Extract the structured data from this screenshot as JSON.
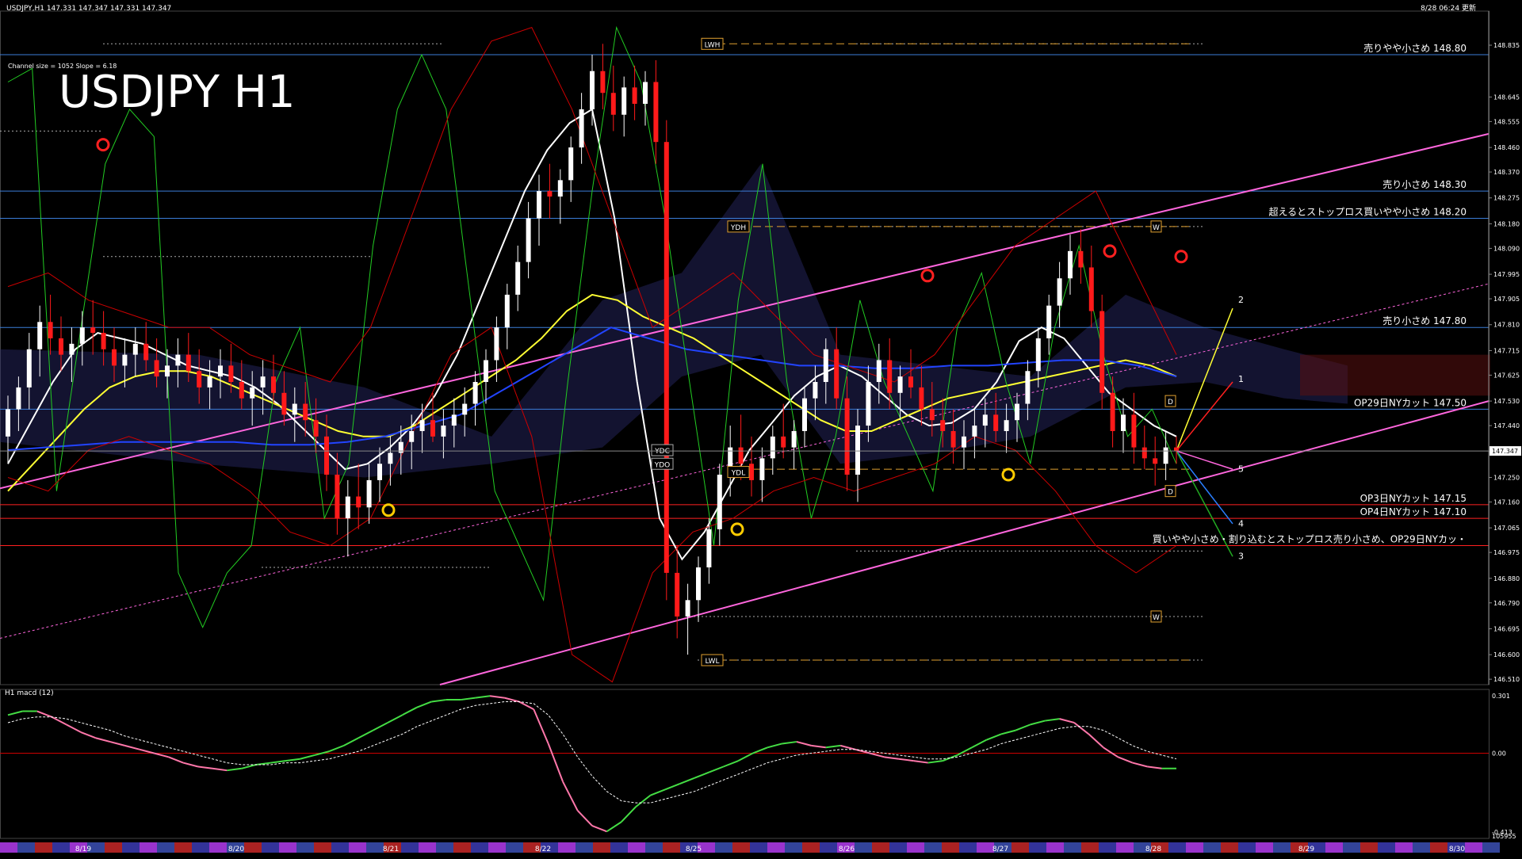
{
  "header": {
    "symbol_info": "USDJPY,H1  147.331 147.347 147.331 147.347",
    "channel_info": "Channel size = 1052 Slope = 6.18",
    "title": "USDJPY H1",
    "update_time": "8/28 06:24 更新"
  },
  "price_axis": {
    "ticks": [
      "148.835",
      "148.645",
      "148.555",
      "148.460",
      "148.370",
      "148.275",
      "148.180",
      "148.090",
      "147.995",
      "147.905",
      "147.810",
      "147.715",
      "147.625",
      "147.530",
      "147.440",
      "147.345",
      "147.250",
      "147.160",
      "147.065",
      "146.975",
      "146.880",
      "146.790",
      "146.695",
      "146.600",
      "146.510"
    ],
    "current_price": "147.347",
    "range": [
      146.49,
      148.96
    ]
  },
  "levels": [
    {
      "price": 148.8,
      "label": "売りやや小さめ 148.80",
      "color": "#3b7dd8"
    },
    {
      "price": 148.3,
      "label": "売り小さめ 148.30",
      "color": "#3b7dd8"
    },
    {
      "price": 148.2,
      "label": "超えるとストップロス買いやや小さめ 148.20",
      "color": "#3b7dd8"
    },
    {
      "price": 147.8,
      "label": "売り小さめ 147.80",
      "color": "#3b7dd8"
    },
    {
      "price": 147.5,
      "label": "OP29日NYカット 147.50",
      "color": "#3b7dd8"
    },
    {
      "price": 147.15,
      "label": "OP3日NYカット 147.15",
      "color": "#ff2020"
    },
    {
      "price": 147.1,
      "label": "OP4日NYカット 147.10",
      "color": "#ff2020"
    },
    {
      "price": 147.0,
      "label": "買いやや小さめ・割り込むとストップロス売り小さめ、OP29日NYカッ・",
      "color": "#ff2020"
    }
  ],
  "price_tags": [
    "LWH",
    "LWL",
    "YDH",
    "YDL",
    "YDC",
    "YDO",
    "W",
    "W",
    "D",
    "D"
  ],
  "wave_labels": [
    "1",
    "2",
    "3",
    "4",
    "5"
  ],
  "date_axis": [
    "8/19",
    "8/20",
    "8/21",
    "8/22",
    "8/25",
    "8/26",
    "8/27",
    "8/28",
    "8/29",
    "8/30"
  ],
  "macd": {
    "label": "H1 macd (12)",
    "ticks": [
      "0.301",
      "0.00",
      "-0.413",
      "105955"
    ],
    "range": [
      -0.413,
      0.301
    ]
  },
  "colors": {
    "background": "#000000",
    "up_candle": "#ffffff",
    "down_candle": "#ff1a1a",
    "channel": "#ff66dd",
    "ma_fast": "#ffffff",
    "ma_mid": "#ffff33",
    "ma_slow": "#2244ff",
    "oscillator": "#22cc22",
    "bollinger": "#cc0000",
    "level_blue": "#3b7dd8",
    "macd_up": "#44dd44",
    "macd_down": "#ff77aa",
    "signal": "#ffffff"
  },
  "chart_data": {
    "type": "candlestick",
    "title": "USDJPY H1",
    "x_categories": [
      "8/19",
      "8/20",
      "8/21",
      "8/22",
      "8/25",
      "8/26",
      "8/27",
      "8/28",
      "8/29",
      "8/30"
    ],
    "ylim": [
      146.49,
      148.96
    ],
    "ohlc": [
      [
        147.4,
        147.55,
        147.3,
        147.5
      ],
      [
        147.5,
        147.62,
        147.42,
        147.58
      ],
      [
        147.58,
        147.78,
        147.5,
        147.72
      ],
      [
        147.72,
        147.88,
        147.62,
        147.82
      ],
      [
        147.82,
        147.92,
        147.7,
        147.76
      ],
      [
        147.76,
        147.84,
        147.64,
        147.7
      ],
      [
        147.7,
        147.8,
        147.6,
        147.74
      ],
      [
        147.74,
        147.86,
        147.66,
        147.8
      ],
      [
        147.8,
        147.9,
        147.7,
        147.78
      ],
      [
        147.78,
        147.86,
        147.66,
        147.72
      ],
      [
        147.72,
        147.8,
        147.6,
        147.66
      ],
      [
        147.66,
        147.76,
        147.58,
        147.7
      ],
      [
        147.7,
        147.8,
        147.62,
        147.74
      ],
      [
        147.74,
        147.82,
        147.64,
        147.68
      ],
      [
        147.68,
        147.76,
        147.58,
        147.62
      ],
      [
        147.62,
        147.72,
        147.54,
        147.66
      ],
      [
        147.66,
        147.76,
        147.58,
        147.7
      ],
      [
        147.7,
        147.78,
        147.6,
        147.64
      ],
      [
        147.64,
        147.72,
        147.52,
        147.58
      ],
      [
        147.58,
        147.68,
        147.5,
        147.62
      ],
      [
        147.62,
        147.72,
        147.54,
        147.66
      ],
      [
        147.66,
        147.74,
        147.56,
        147.6
      ],
      [
        147.6,
        147.68,
        147.5,
        147.54
      ],
      [
        147.54,
        147.64,
        147.44,
        147.58
      ],
      [
        147.58,
        147.68,
        147.48,
        147.62
      ],
      [
        147.62,
        147.7,
        147.52,
        147.56
      ],
      [
        147.56,
        147.64,
        147.44,
        147.48
      ],
      [
        147.48,
        147.58,
        147.38,
        147.52
      ],
      [
        147.52,
        147.6,
        147.4,
        147.46
      ],
      [
        147.46,
        147.54,
        147.34,
        147.4
      ],
      [
        147.4,
        147.48,
        147.2,
        147.26
      ],
      [
        147.26,
        147.34,
        147.04,
        147.1
      ],
      [
        147.1,
        147.24,
        146.96,
        147.18
      ],
      [
        147.18,
        147.3,
        147.06,
        147.14
      ],
      [
        147.14,
        147.3,
        147.08,
        147.24
      ],
      [
        147.24,
        147.36,
        147.16,
        147.3
      ],
      [
        147.3,
        147.4,
        147.22,
        147.34
      ],
      [
        147.34,
        147.44,
        147.26,
        147.38
      ],
      [
        147.38,
        147.48,
        147.28,
        147.42
      ],
      [
        147.42,
        147.52,
        147.34,
        147.46
      ],
      [
        147.46,
        147.56,
        147.38,
        147.4
      ],
      [
        147.4,
        147.5,
        147.32,
        147.44
      ],
      [
        147.44,
        147.54,
        147.36,
        147.48
      ],
      [
        147.48,
        147.58,
        147.4,
        147.52
      ],
      [
        147.52,
        147.64,
        147.44,
        147.6
      ],
      [
        147.6,
        147.72,
        147.52,
        147.68
      ],
      [
        147.68,
        147.84,
        147.6,
        147.8
      ],
      [
        147.8,
        147.96,
        147.72,
        147.92
      ],
      [
        147.92,
        148.1,
        147.86,
        148.04
      ],
      [
        148.04,
        148.26,
        147.98,
        148.2
      ],
      [
        148.2,
        148.36,
        148.1,
        148.3
      ],
      [
        148.3,
        148.4,
        148.2,
        148.28
      ],
      [
        148.28,
        148.38,
        148.18,
        148.34
      ],
      [
        148.34,
        148.5,
        148.26,
        148.46
      ],
      [
        148.46,
        148.66,
        148.4,
        148.6
      ],
      [
        148.6,
        148.8,
        148.54,
        148.74
      ],
      [
        148.74,
        148.84,
        148.6,
        148.66
      ],
      [
        148.66,
        148.76,
        148.52,
        148.58
      ],
      [
        148.58,
        148.72,
        148.5,
        148.68
      ],
      [
        148.68,
        148.76,
        148.56,
        148.62
      ],
      [
        148.62,
        148.74,
        148.54,
        148.7
      ],
      [
        148.7,
        148.78,
        148.4,
        148.48
      ],
      [
        148.48,
        148.56,
        146.8,
        146.9
      ],
      [
        146.9,
        147.0,
        146.66,
        146.74
      ],
      [
        146.74,
        146.86,
        146.6,
        146.8
      ],
      [
        146.8,
        146.96,
        146.72,
        146.92
      ],
      [
        146.92,
        147.1,
        146.86,
        147.06
      ],
      [
        147.06,
        147.3,
        147.0,
        147.26
      ],
      [
        147.26,
        147.44,
        147.18,
        147.36
      ],
      [
        147.36,
        147.48,
        147.24,
        147.3
      ],
      [
        147.3,
        147.4,
        147.18,
        147.24
      ],
      [
        147.24,
        147.36,
        147.16,
        147.32
      ],
      [
        147.32,
        147.44,
        147.26,
        147.4
      ],
      [
        147.4,
        147.52,
        147.32,
        147.36
      ],
      [
        147.36,
        147.46,
        147.28,
        147.42
      ],
      [
        147.42,
        147.58,
        147.36,
        147.54
      ],
      [
        147.54,
        147.66,
        147.46,
        147.6
      ],
      [
        147.6,
        147.76,
        147.52,
        147.72
      ],
      [
        147.72,
        147.8,
        147.5,
        147.54
      ],
      [
        147.54,
        147.62,
        147.2,
        147.26
      ],
      [
        147.26,
        147.5,
        147.16,
        147.44
      ],
      [
        147.44,
        147.66,
        147.38,
        147.6
      ],
      [
        147.6,
        147.74,
        147.52,
        147.68
      ],
      [
        147.68,
        147.76,
        147.5,
        147.56
      ],
      [
        147.56,
        147.66,
        147.46,
        147.62
      ],
      [
        147.62,
        147.72,
        147.54,
        147.58
      ],
      [
        147.58,
        147.66,
        147.44,
        147.5
      ],
      [
        147.5,
        147.6,
        147.4,
        147.46
      ],
      [
        147.46,
        147.54,
        147.36,
        147.42
      ],
      [
        147.42,
        147.5,
        147.3,
        147.36
      ],
      [
        147.36,
        147.46,
        147.28,
        147.4
      ],
      [
        147.4,
        147.5,
        147.32,
        147.44
      ],
      [
        147.44,
        147.54,
        147.36,
        147.48
      ],
      [
        147.48,
        147.56,
        147.38,
        147.42
      ],
      [
        147.42,
        147.52,
        147.34,
        147.46
      ],
      [
        147.46,
        147.56,
        147.38,
        147.52
      ],
      [
        147.52,
        147.68,
        147.46,
        147.64
      ],
      [
        147.64,
        147.8,
        147.58,
        147.76
      ],
      [
        147.76,
        147.92,
        147.7,
        147.88
      ],
      [
        147.88,
        148.04,
        147.8,
        147.98
      ],
      [
        147.98,
        148.14,
        147.92,
        148.08
      ],
      [
        148.08,
        148.16,
        147.96,
        148.02
      ],
      [
        148.02,
        148.1,
        147.8,
        147.86
      ],
      [
        147.86,
        147.92,
        147.5,
        147.56
      ],
      [
        147.56,
        147.62,
        147.36,
        147.42
      ],
      [
        147.42,
        147.54,
        147.34,
        147.48
      ],
      [
        147.48,
        147.56,
        147.3,
        147.36
      ],
      [
        147.36,
        147.44,
        147.28,
        147.32
      ],
      [
        147.32,
        147.4,
        147.22,
        147.3
      ],
      [
        147.3,
        147.42,
        147.24,
        147.36
      ],
      [
        147.36,
        147.4,
        147.3,
        147.347
      ]
    ],
    "series": [
      {
        "values": [
          147.3,
          147.45,
          147.6,
          147.72,
          147.78,
          147.76,
          147.74,
          147.7,
          147.66,
          147.64,
          147.62,
          147.58,
          147.52,
          147.44,
          147.36,
          147.28,
          147.3,
          147.36,
          147.44,
          147.55,
          147.7,
          147.9,
          148.1,
          148.3,
          148.45,
          148.55,
          148.6,
          148.2,
          147.6,
          147.1,
          146.95,
          147.05,
          147.2,
          147.35,
          147.45,
          147.55,
          147.62,
          147.66,
          147.62,
          147.55,
          147.48,
          147.44,
          147.45,
          147.5,
          147.6,
          147.75,
          147.8,
          147.76,
          147.66,
          147.56,
          147.5,
          147.44,
          147.4
        ]
      },
      {
        "values": [
          147.2,
          147.3,
          147.4,
          147.5,
          147.58,
          147.62,
          147.64,
          147.64,
          147.62,
          147.58,
          147.54,
          147.5,
          147.46,
          147.42,
          147.4,
          147.4,
          147.44,
          147.5,
          147.56,
          147.62,
          147.68,
          147.76,
          147.86,
          147.92,
          147.9,
          147.84,
          147.8,
          147.76,
          147.7,
          147.64,
          147.58,
          147.52,
          147.46,
          147.42,
          147.42,
          147.46,
          147.5,
          147.54,
          147.56,
          147.58,
          147.6,
          147.62,
          147.64,
          147.66,
          147.68,
          147.66,
          147.62
        ]
      },
      {
        "values": [
          147.35,
          147.36,
          147.37,
          147.38,
          147.38,
          147.38,
          147.38,
          147.37,
          147.37,
          147.38,
          147.4,
          147.44,
          147.48,
          147.56,
          147.64,
          147.72,
          147.8,
          147.76,
          147.72,
          147.7,
          147.68,
          147.66,
          147.66,
          147.65,
          147.65,
          147.66,
          147.66,
          147.67,
          147.68,
          147.68,
          147.66,
          147.62
        ]
      }
    ],
    "macd": {
      "name": "H1 macd (12)",
      "main": [
        0.2,
        0.22,
        0.22,
        0.19,
        0.15,
        0.11,
        0.08,
        0.06,
        0.04,
        0.02,
        0.0,
        -0.02,
        -0.05,
        -0.07,
        -0.08,
        -0.09,
        -0.08,
        -0.06,
        -0.05,
        -0.04,
        -0.03,
        -0.01,
        0.01,
        0.04,
        0.08,
        0.12,
        0.16,
        0.2,
        0.24,
        0.27,
        0.28,
        0.28,
        0.29,
        0.3,
        0.29,
        0.27,
        0.23,
        0.05,
        -0.15,
        -0.3,
        -0.38,
        -0.41,
        -0.36,
        -0.28,
        -0.22,
        -0.19,
        -0.16,
        -0.13,
        -0.1,
        -0.07,
        -0.04,
        0.0,
        0.03,
        0.05,
        0.06,
        0.04,
        0.03,
        0.04,
        0.02,
        0.0,
        -0.02,
        -0.03,
        -0.04,
        -0.05,
        -0.04,
        -0.01,
        0.03,
        0.07,
        0.1,
        0.12,
        0.15,
        0.17,
        0.18,
        0.16,
        0.1,
        0.03,
        -0.02,
        -0.05,
        -0.07,
        -0.08,
        -0.08
      ],
      "signal": [
        0.16,
        0.18,
        0.19,
        0.19,
        0.18,
        0.16,
        0.14,
        0.12,
        0.09,
        0.07,
        0.05,
        0.03,
        0.01,
        -0.01,
        -0.03,
        -0.05,
        -0.06,
        -0.06,
        -0.06,
        -0.05,
        -0.05,
        -0.04,
        -0.03,
        -0.01,
        0.01,
        0.04,
        0.07,
        0.1,
        0.14,
        0.17,
        0.2,
        0.23,
        0.25,
        0.26,
        0.27,
        0.27,
        0.26,
        0.2,
        0.1,
        -0.02,
        -0.12,
        -0.2,
        -0.25,
        -0.26,
        -0.26,
        -0.24,
        -0.22,
        -0.2,
        -0.17,
        -0.14,
        -0.11,
        -0.08,
        -0.05,
        -0.03,
        -0.01,
        0.0,
        0.01,
        0.02,
        0.02,
        0.01,
        0.0,
        -0.01,
        -0.02,
        -0.03,
        -0.03,
        -0.02,
        0.0,
        0.02,
        0.05,
        0.07,
        0.09,
        0.11,
        0.13,
        0.14,
        0.14,
        0.12,
        0.08,
        0.04,
        0.01,
        -0.01,
        -0.03
      ]
    }
  }
}
